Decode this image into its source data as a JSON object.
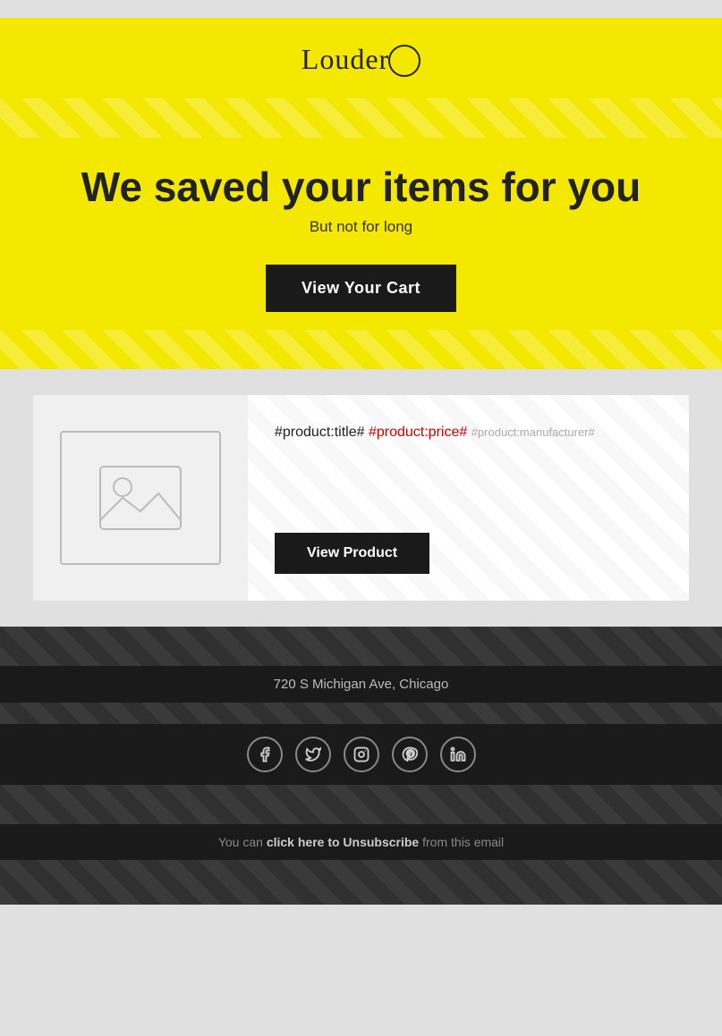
{
  "header": {
    "logo_text": "Louder",
    "hero_title": "We saved your items for you",
    "hero_subtitle": "But not for long",
    "cta_label": "View Your Cart"
  },
  "product": {
    "title": "#product:title#",
    "price": "#product:price#",
    "manufacturer": "#product:manufacturer#",
    "view_button_label": "View Product",
    "image_alt": "Product image placeholder"
  },
  "footer": {
    "address": "720 S Michigan Ave, Chicago",
    "unsubscribe_prefix": "You can ",
    "unsubscribe_link_text": "click here to Unsubscribe",
    "unsubscribe_suffix": " from this email",
    "social": {
      "facebook": "f",
      "twitter": "t",
      "instagram": "i",
      "pinterest": "p",
      "linkedin": "in"
    }
  }
}
